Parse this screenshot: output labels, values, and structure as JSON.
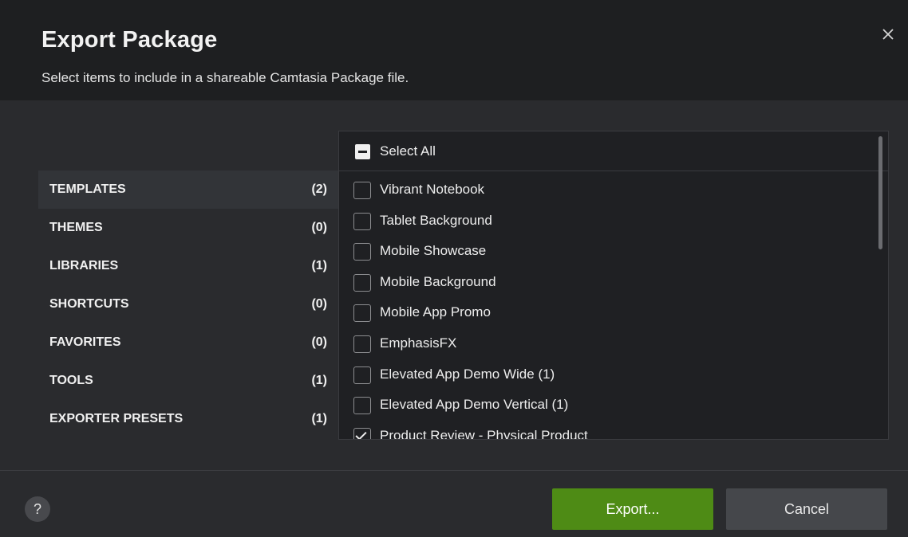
{
  "dialog": {
    "title": "Export Package",
    "subtitle": "Select items to include in a shareable Camtasia Package file.",
    "close_icon": "close-icon"
  },
  "categories": [
    {
      "label": "TEMPLATES",
      "count": "(2)",
      "active": true
    },
    {
      "label": "THEMES",
      "count": "(0)",
      "active": false
    },
    {
      "label": "LIBRARIES",
      "count": "(1)",
      "active": false
    },
    {
      "label": "SHORTCUTS",
      "count": "(0)",
      "active": false
    },
    {
      "label": "FAVORITES",
      "count": "(0)",
      "active": false
    },
    {
      "label": "TOOLS",
      "count": "(1)",
      "active": false
    },
    {
      "label": "EXPORTER PRESETS",
      "count": "(1)",
      "active": false
    }
  ],
  "select_all": {
    "label": "Select All",
    "state": "indeterminate"
  },
  "items": [
    {
      "label": "Vibrant Notebook",
      "checked": false
    },
    {
      "label": "Tablet Background",
      "checked": false
    },
    {
      "label": "Mobile Showcase",
      "checked": false
    },
    {
      "label": "Mobile Background",
      "checked": false
    },
    {
      "label": "Mobile App Promo",
      "checked": false
    },
    {
      "label": "EmphasisFX",
      "checked": false
    },
    {
      "label": "Elevated App Demo Wide (1)",
      "checked": false
    },
    {
      "label": "Elevated App Demo Vertical (1)",
      "checked": false
    },
    {
      "label": "Product Review - Physical Product",
      "checked": true
    }
  ],
  "footer": {
    "help_label": "?",
    "export_label": "Export...",
    "cancel_label": "Cancel"
  },
  "colors": {
    "accent": "#4e8b15",
    "background": "#2a2b2e",
    "header": "#1e1f21"
  }
}
